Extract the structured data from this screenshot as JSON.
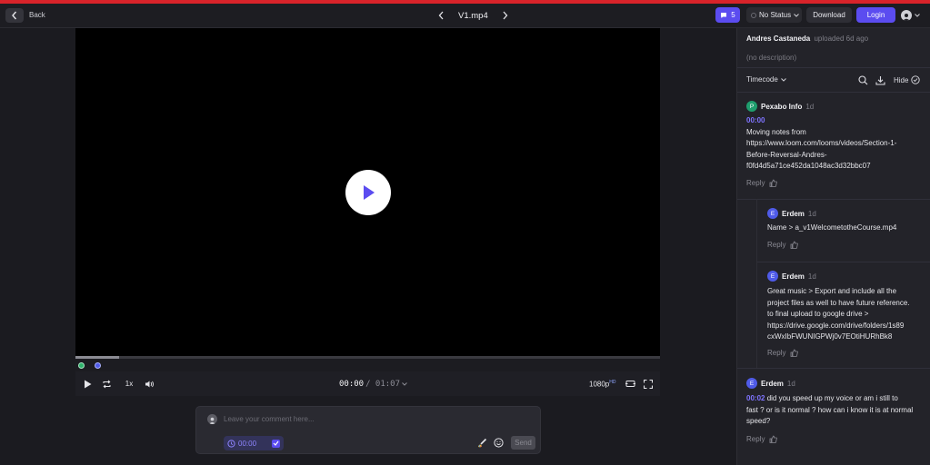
{
  "header": {
    "back_label": "Back",
    "file_title": "V1.mp4",
    "comment_count": "5",
    "status_label": "No Status",
    "download_label": "Download",
    "login_label": "Login"
  },
  "player": {
    "current_time": "00:00",
    "duration": "/ 01:07",
    "speed": "1x",
    "quality": "1080p",
    "quality_badge": "HD",
    "progress_fraction": 0.075
  },
  "composer": {
    "placeholder": "Leave your comment here...",
    "timestamp": "00:00",
    "send_label": "Send"
  },
  "sidebar": {
    "uploader": "Andres Castaneda",
    "uploaded_meta": "uploaded 6d ago",
    "description": "(no description)",
    "timecode_label": "Timecode",
    "hide_label": "Hide",
    "reply_label": "Reply",
    "comments": [
      {
        "initial": "P",
        "author": "Pexabo Info",
        "age": "1d",
        "timecode": "00:00",
        "lines": [
          "Moving notes from",
          "https://www.loom.com/looms/videos/Section-1-",
          "Before-Reversal-Andres-",
          "f0fd4d5a71ce452da1048ac3d32bbc07"
        ],
        "color": "#1f9e6e"
      },
      {
        "initial": "E",
        "author": "Erdem",
        "age": "1d",
        "lines": [
          "Name > a_v1WelcometotheCourse.mp4"
        ],
        "color": "#4f5be8"
      },
      {
        "initial": "E",
        "author": "Erdem",
        "age": "1d",
        "lines": [
          "Great music > Export and include all the",
          "project files as well to have future reference.",
          "to final upload to google drive >",
          "https://drive.google.com/drive/folders/1s89",
          "cxWxIbFWUNIGPWj0v7EOtiHURhBk8"
        ],
        "color": "#4f5be8"
      },
      {
        "initial": "E",
        "author": "Erdem",
        "age": "1d",
        "timecode": "00:02",
        "lines": [
          "did you speed up my voice or am i still to",
          "fast ? or is it normal ? how can i know it is at normal",
          "speed?"
        ],
        "color": "#4f5be8"
      }
    ]
  },
  "colors": {
    "accent": "#5b4cf0",
    "top_stripe": "#d8232a",
    "marker_green": "#2fb36b",
    "marker_blue": "#4f5be8"
  }
}
